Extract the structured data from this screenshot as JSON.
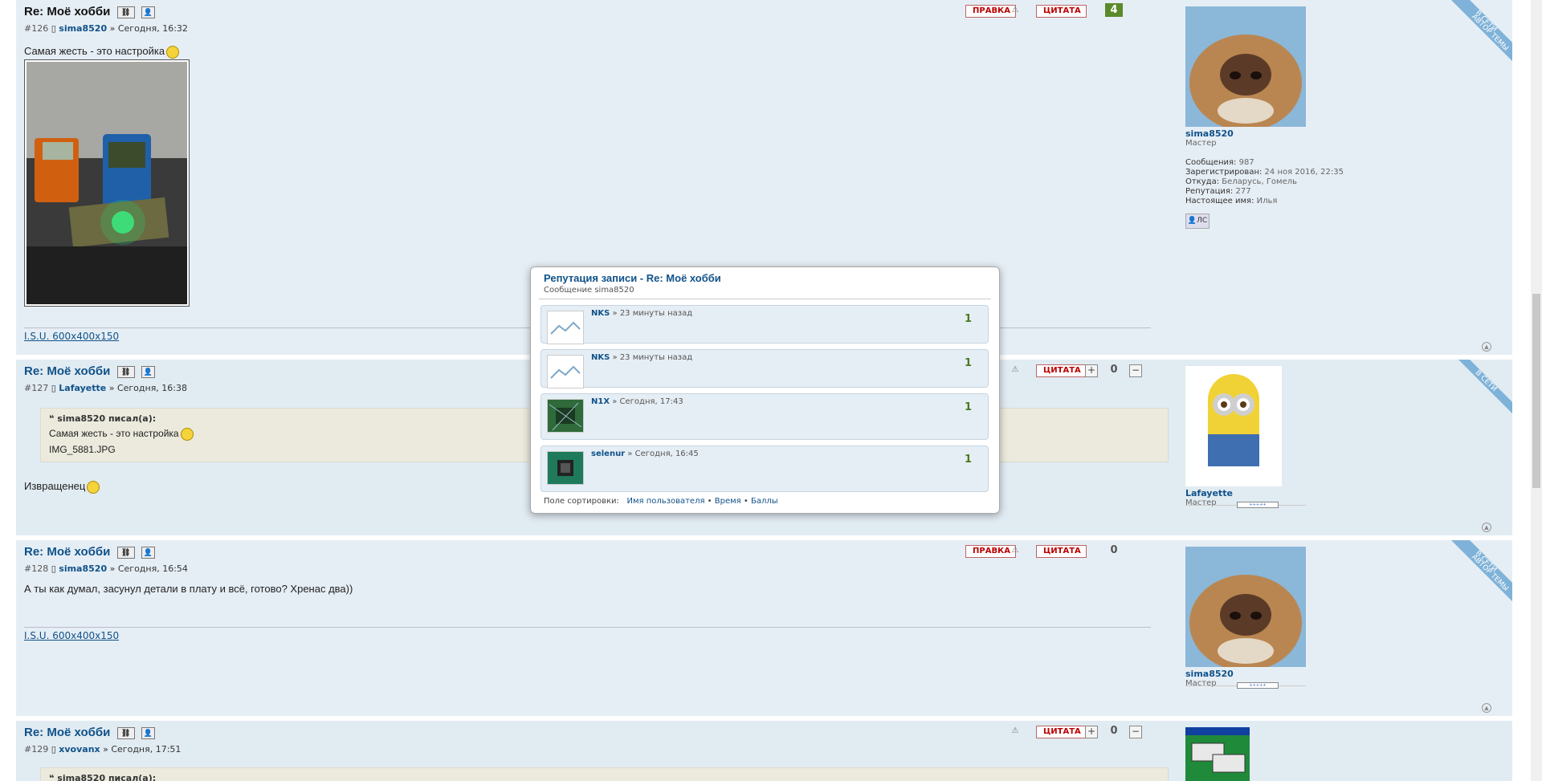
{
  "colors": {
    "link": "#105289",
    "post_bg": "#e6eef5",
    "positive": "#5a8a2a",
    "button_red": "#bb0000",
    "ribbon": "#7fb2d8"
  },
  "labels": {
    "edit": "ПРАВКА",
    "quote": "ЦИТАТА",
    "pm": "ЛС",
    "online": "В СЕТИ",
    "author": "АВТОР ТЕМЫ",
    "sep": "»"
  },
  "posts": [
    {
      "title": "Re: Моё хобби",
      "num": "#126",
      "user": "sima8520",
      "time": "Сегодня, 16:32",
      "text": "Самая жесть - это настройка",
      "image_caption": "",
      "signature": "I.S.U. 600x400x150",
      "score": "4",
      "profile": {
        "name": "sima8520",
        "rank": "Мастер",
        "stats": [
          {
            "k": "Сообщения:",
            "v": "987"
          },
          {
            "k": "Зарегистрирован:",
            "v": "24 ноя 2016, 22:35"
          },
          {
            "k": "Откуда:",
            "v": "Беларусь, Гомель"
          },
          {
            "k": "Репутация:",
            "v": "277"
          },
          {
            "k": "Настоящее имя:",
            "v": "Илья"
          }
        ]
      }
    },
    {
      "title": "Re: Моё хобби",
      "num": "#127",
      "user": "Lafayette",
      "time": "Сегодня, 16:38",
      "quote_header": "sima8520 писал(а):",
      "quote_text": "Самая жесть - это настройка",
      "quote_file": "IMG_5881.JPG",
      "text": "Извращенец",
      "score": "0",
      "profile": {
        "name": "Lafayette",
        "rank": "Мастер"
      }
    },
    {
      "title": "Re: Моё хобби",
      "num": "#128",
      "user": "sima8520",
      "time": "Сегодня, 16:54",
      "text": "А ты как думал, засунул детали в плату и всё, готово? Хренас два))",
      "signature": "I.S.U. 600x400x150",
      "score": "0",
      "profile": {
        "name": "sima8520",
        "rank": "Мастер"
      }
    },
    {
      "title": "Re: Моё хобби",
      "num": "#129",
      "user": "xvovanx",
      "time": "Сегодня, 17:51",
      "quote_header": "sima8520 писал(а):",
      "score": "0"
    }
  ],
  "popup": {
    "title": "Репутация записи - Re: Моё хобби",
    "subtitle": "Сообщение sima8520",
    "items": [
      {
        "user": "NKS",
        "time": "» 23 минуты назад",
        "points": "1"
      },
      {
        "user": "NKS",
        "time": "» 23 минуты назад",
        "points": "1"
      },
      {
        "user": "N1X",
        "time": "» Сегодня, 17:43",
        "points": "1"
      },
      {
        "user": "selenur",
        "time": "» Сегодня, 16:45",
        "points": "1"
      }
    ],
    "sort_label": "Поле сортировки:",
    "sort_options": [
      "Имя пользователя",
      "Время",
      "Баллы"
    ],
    "sort_sep": "•"
  }
}
